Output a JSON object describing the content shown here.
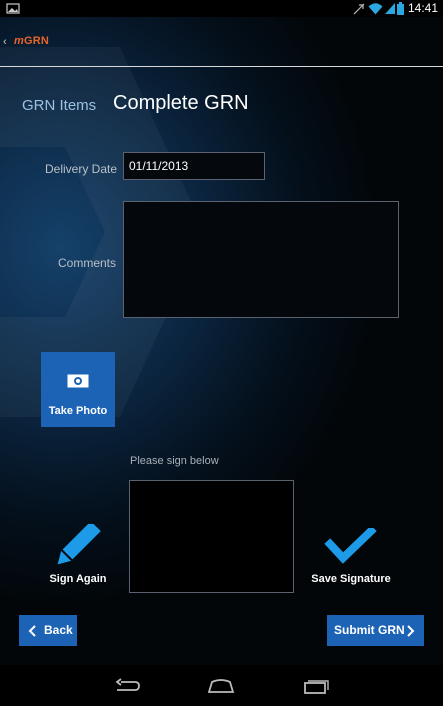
{
  "status_bar": {
    "time": "14:41"
  },
  "app_bar": {
    "back_caret": "‹",
    "logo_prefix": "m",
    "logo_text": "GRN"
  },
  "header": {
    "breadcrumb": "GRN Items",
    "title": "Complete GRN"
  },
  "form": {
    "delivery_date_label": "Delivery Date",
    "delivery_date_value": "01/11/2013",
    "comments_label": "Comments",
    "comments_value": ""
  },
  "photo": {
    "button_label": "Take Photo"
  },
  "signature": {
    "hint": "Please sign below",
    "sign_again_label": "Sign Again",
    "save_label": "Save Signature"
  },
  "footer": {
    "back_label": "Back",
    "submit_label": "Submit GRN"
  },
  "colors": {
    "accent": "#1d63b5",
    "logo": "#e8652a",
    "icon_blue": "#1d9be8"
  },
  "icons": [
    "image-icon",
    "wifi-icon",
    "signal-icon",
    "battery-icon",
    "camera-icon",
    "pencil-icon",
    "checkmark-icon",
    "chevron-left-icon",
    "chevron-right-icon",
    "nav-back-icon",
    "nav-home-icon",
    "nav-recents-icon"
  ]
}
